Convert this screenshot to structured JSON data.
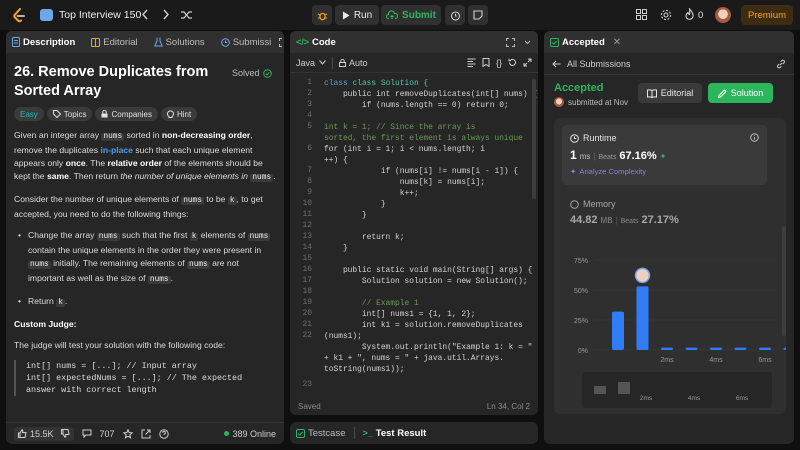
{
  "topbar": {
    "problem_list": "Top Interview 150",
    "run": "Run",
    "submit": "Submit",
    "streak": "0",
    "premium": "Premium"
  },
  "desc": {
    "tabs": [
      "Description",
      "Editorial",
      "Solutions",
      "Submissi"
    ],
    "title": "26. Remove Duplicates from Sorted Array",
    "solved": "Solved",
    "difficulty": "Easy",
    "tag_topics": "Topics",
    "tag_companies": "Companies",
    "tag_hint": "Hint",
    "p1": [
      "Given an integer array ",
      "nums",
      " sorted in ",
      "non-decreasing order",
      ", remove the duplicates ",
      "in-place",
      " such that each unique element appears only ",
      "once",
      ". The ",
      "relative order",
      " of the elements should be kept the ",
      "same",
      ". Then return ",
      "the number of unique elements in ",
      "nums",
      "."
    ],
    "p2": [
      "Consider the number of unique elements of ",
      "nums",
      " to be ",
      "k",
      ", to get accepted, you need to do the following things:"
    ],
    "li1": [
      "Change the array ",
      "nums",
      " such that the first ",
      "k",
      " elements of ",
      "nums",
      " contain the unique elements in the order they were present in ",
      "nums",
      " initially. The remaining elements of ",
      "nums",
      " are not important as well as the size of ",
      "nums",
      "."
    ],
    "li2": [
      "Return ",
      "k",
      "."
    ],
    "custom_judge": "Custom Judge:",
    "p3": "The judge will test your solution with the following code:",
    "code": [
      "int[] nums = [...]; // Input array",
      "int[] expectedNums = [...]; // The expected",
      "answer with correct length"
    ],
    "likes": "15.5K",
    "comments": "707",
    "online": "389 Online"
  },
  "code": {
    "tab": "Code",
    "language": "Java",
    "auto": "Auto",
    "status_left": "Saved",
    "status_right": "Ln 34, Col 2",
    "line_numbers": [
      "1",
      "2",
      "3",
      "4",
      "5",
      "6",
      "7",
      "8",
      "9",
      "10",
      "11",
      "12",
      "13",
      "14",
      "15",
      "16",
      "17",
      "18",
      "19",
      "20",
      "21",
      "22",
      "23"
    ],
    "lines": [
      "class Solution {",
      "    public int removeDuplicates(int[] nums) {",
      "        if (nums.length == 0) return 0;",
      "",
      "        int k = 1; // Since the array is",
      "sorted, the first element is always unique",
      "        for (int i = 1; i < nums.length; i",
      "++) {",
      "            if (nums[i] != nums[i - 1]) {",
      "                nums[k] = nums[i];",
      "                k++;",
      "            }",
      "        }",
      "",
      "        return k;",
      "    }",
      "",
      "    public static void main(String[] args) {",
      "        Solution solution = new Solution();",
      "",
      "        // Example 1",
      "        int[] nums1 = {1, 1, 2};",
      "        int k1 = solution.removeDuplicates",
      "(nums1);",
      "        System.out.println(\"Example 1: k = \"",
      "+ k1 + \", nums = \" + java.util.Arrays.",
      "toString(nums1));"
    ]
  },
  "bottom": {
    "testcase": "Testcase",
    "test_result": "Test Result"
  },
  "result": {
    "tab": "Accepted",
    "all_submissions": "All Submissions",
    "status": "Accepted",
    "submitted": "submitted at Nov",
    "editorial": "Editorial",
    "solution": "Solution",
    "runtime_label": "Runtime",
    "runtime_value": "1",
    "runtime_unit": "ms",
    "beats": "Beats",
    "runtime_beats": "67.16%",
    "analyze": "Analyze Complexity",
    "memory_label": "Memory",
    "memory_value": "44.82",
    "memory_unit": "MB",
    "memory_beats": "27.17%"
  },
  "colors": {
    "accent_green": "#2db55d",
    "orange": "#ffa116",
    "bar_blue": "#2f7cf6"
  },
  "chart_data": {
    "type": "bar",
    "y_ticks": [
      "75%",
      "50%",
      "25%",
      "0%"
    ],
    "ylim": [
      0,
      75
    ],
    "x_tick_labels": [
      "2ms",
      "4ms",
      "6ms"
    ],
    "values": [
      32,
      53,
      2,
      2,
      2,
      2,
      2,
      2
    ],
    "highlight_index": 1,
    "mini_tick_labels": [
      "2ms",
      "4ms",
      "6ms"
    ]
  }
}
